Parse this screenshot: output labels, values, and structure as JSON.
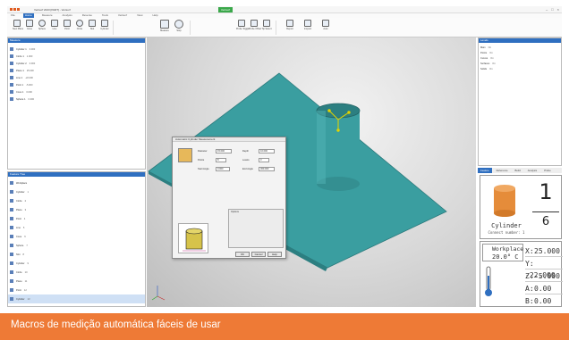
{
  "window": {
    "title": "Verisurf 2023 [PART] - Verisurf",
    "context_tab": "Verisurf"
  },
  "ribbon": {
    "tabs": [
      "File",
      "Home",
      "Measure",
      "Analysis",
      "Reverse",
      "Tools",
      "Verisurf",
      "View",
      "Help"
    ],
    "groups": [
      {
        "name": "Align",
        "buttons": [
          "New Plane",
          "Cone",
          "Sphere",
          "Line",
          "Point",
          "Circle",
          "Slot",
          "Cylinder"
        ]
      },
      {
        "name": "Construct",
        "buttons": [
          "Measure",
          "Stop"
        ]
      },
      {
        "name": "Probe",
        "buttons": [
          "Probe Toggle",
          "Probe Offset",
          "Tip Select"
        ]
      },
      {
        "name": "Report",
        "buttons": [
          "Report",
          "Inspect",
          "Auto"
        ]
      }
    ]
  },
  "left_panel": {
    "title": "Measure",
    "rows": [
      {
        "label": "Cylinder 1",
        "value": "0.000"
      },
      {
        "label": "Circle 1",
        "value": "1.000"
      },
      {
        "label": "Cylinder 2",
        "value": "0.000"
      },
      {
        "label": "Plane 1",
        "value": "25.000"
      },
      {
        "label": "Line 1",
        "value": "-22.000"
      },
      {
        "label": "Point 1",
        "value": "-5.000"
      },
      {
        "label": "Cone 1",
        "value": "0.000"
      },
      {
        "label": "Sphere 1",
        "value": "0.000"
      }
    ]
  },
  "bottom_left_panel": {
    "title": "Feature Tree",
    "rows": [
      {
        "label": "Workplace",
        "value": ""
      },
      {
        "label": "Cylinder",
        "value": "1"
      },
      {
        "label": "Circle",
        "value": "2"
      },
      {
        "label": "Plane",
        "value": "3"
      },
      {
        "label": "Point",
        "value": "4"
      },
      {
        "label": "Line",
        "value": "5"
      },
      {
        "label": "Cone",
        "value": "6"
      },
      {
        "label": "Sphere",
        "value": "7"
      },
      {
        "label": "Slot",
        "value": "8"
      },
      {
        "label": "Cylinder",
        "value": "9"
      },
      {
        "label": "Circle",
        "value": "10"
      },
      {
        "label": "Plane",
        "value": "11"
      },
      {
        "label": "Point",
        "value": "12"
      },
      {
        "label": "Cylinder",
        "value": "13"
      }
    ]
  },
  "right_top_panel": {
    "title": "Levels",
    "rows": [
      {
        "label": "Main",
        "value": "On"
      },
      {
        "label": "Points",
        "value": "On"
      },
      {
        "label": "Curves",
        "value": "On"
      },
      {
        "label": "Surfaces",
        "value": "On"
      },
      {
        "label": "Solids",
        "value": "On"
      }
    ]
  },
  "dialog": {
    "title": "Automatic Cylinder Measurement",
    "fields": [
      {
        "label": "Diameter",
        "value": "15.000"
      },
      {
        "label": "Depth",
        "value": "10.000"
      },
      {
        "label": "Points",
        "value": "8"
      },
      {
        "label": "Levels",
        "value": "3"
      },
      {
        "label": "Start Angle",
        "value": "0.000"
      },
      {
        "label": "End Angle",
        "value": "360.000"
      }
    ],
    "section": "Options",
    "buttons": [
      "OK",
      "Cancel",
      "Help"
    ]
  },
  "right_tabs": [
    "Feature",
    "Reference",
    "Build",
    "Analysis",
    "Probe"
  ],
  "feature_info": {
    "name": "Cylinder",
    "connect_label": "Connect number: 1",
    "number": "1",
    "total": "6"
  },
  "workplace": {
    "label": "Workplace",
    "temperature": "20.0° C",
    "axes": [
      {
        "axis": "X:",
        "value": "25.000"
      },
      {
        "axis": "Y:",
        "value": "-22.000"
      },
      {
        "axis": "Z:",
        "value": "-5.000"
      },
      {
        "axis": "A:",
        "value": "0.00"
      },
      {
        "axis": "B:",
        "value": "0.00"
      }
    ]
  },
  "caption": "Macros de medição automática fáceis de usar",
  "colors": {
    "accent": "#ee7a36",
    "ribbon_active": "#2f6fc0",
    "part": "#3a9ea0",
    "cylinder_icon": "#e58c3a"
  }
}
